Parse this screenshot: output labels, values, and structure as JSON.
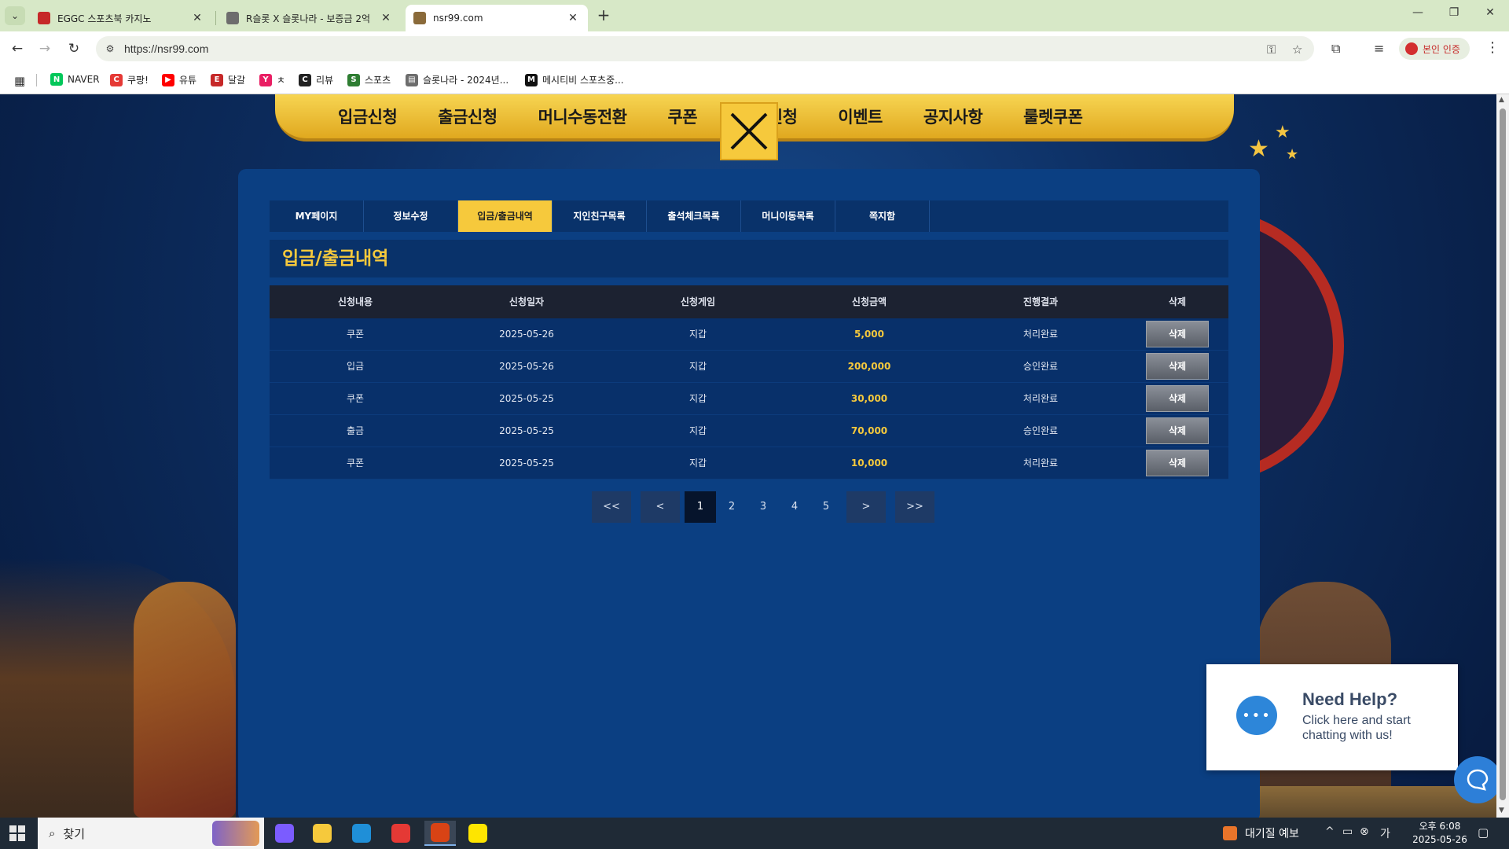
{
  "browser": {
    "tabs": [
      {
        "title": "EGGC 스포츠북 카지노",
        "active": false,
        "favicon_color": "#c62828"
      },
      {
        "title": "R슬롯 X 슬롯나라 - 보증금 2억",
        "active": false,
        "favicon_color": "#6d6d6d"
      },
      {
        "title": "nsr99.com",
        "active": true,
        "favicon_color": "#8a6a3a"
      }
    ],
    "url": "https://nsr99.com",
    "profile_label": "본인 인증",
    "bookmarks": [
      {
        "label": "NAVER",
        "icon_text": "N",
        "color": "#03c75a"
      },
      {
        "label": "쿠팡!",
        "icon_text": "C",
        "color": "#e53935"
      },
      {
        "label": "유튜",
        "icon_text": "▶",
        "color": "#ff0000"
      },
      {
        "label": "달갈",
        "icon_text": "E",
        "color": "#c62828"
      },
      {
        "label": "ㅊ",
        "icon_text": "Y",
        "color": "#e91e63"
      },
      {
        "label": "리뷰",
        "icon_text": "C",
        "color": "#222222"
      },
      {
        "label": "스포츠",
        "icon_text": "S",
        "color": "#2e7d32"
      },
      {
        "label": "슬롯나라 - 2024년...",
        "icon_text": "▤",
        "color": "#6d6d6d"
      },
      {
        "label": "메시티비 스포츠중...",
        "icon_text": "M",
        "color": "#111111"
      }
    ]
  },
  "site": {
    "nav_items": [
      "입금신청",
      "출금신청",
      "머니수동전환",
      "쿠폰",
      "콤프신청",
      "이벤트",
      "공지사항",
      "룰렛쿠폰"
    ],
    "subtabs": [
      "MY페이지",
      "정보수정",
      "입금/출금내역",
      "지인친구목록",
      "출석체크목록",
      "머니이동목록",
      "쪽지함"
    ],
    "active_subtab": 2,
    "section_title": "입금/출금내역",
    "table": {
      "headers": [
        "신청내용",
        "신청일자",
        "신청게임",
        "신청금액",
        "진행결과",
        "삭제"
      ],
      "rows": [
        {
          "type": "쿠폰",
          "date": "2025-05-26",
          "game": "지갑",
          "amount": "5,000",
          "result": "처리완료",
          "action": "삭제"
        },
        {
          "type": "입금",
          "date": "2025-05-26",
          "game": "지갑",
          "amount": "200,000",
          "result": "승인완료",
          "action": "삭제"
        },
        {
          "type": "쿠폰",
          "date": "2025-05-25",
          "game": "지갑",
          "amount": "30,000",
          "result": "처리완료",
          "action": "삭제"
        },
        {
          "type": "출금",
          "date": "2025-05-25",
          "game": "지갑",
          "amount": "70,000",
          "result": "승인완료",
          "action": "삭제"
        },
        {
          "type": "쿠폰",
          "date": "2025-05-25",
          "game": "지갑",
          "amount": "10,000",
          "result": "처리완료",
          "action": "삭제"
        }
      ]
    },
    "pagination": {
      "first": "<<",
      "prev": "<",
      "pages": [
        "1",
        "2",
        "3",
        "4",
        "5"
      ],
      "current": "1",
      "next": ">",
      "last": ">>"
    },
    "help_widget": {
      "title": "Need Help?",
      "text": "Click here and start chatting with us!"
    }
  },
  "taskbar": {
    "search_placeholder": "찾기",
    "weather": "대기질 예보",
    "time": "오후 6:08",
    "date": "2025-05-26",
    "apps": [
      {
        "name": "copilot",
        "color": "#7b5cff"
      },
      {
        "name": "sticky-notes",
        "color": "#f6c93c"
      },
      {
        "name": "edge",
        "color": "#1f8fd8"
      },
      {
        "name": "chrome",
        "color": "#e53935"
      },
      {
        "name": "chrome-profile",
        "color": "#d84315"
      },
      {
        "name": "kakaotalk",
        "color": "#fee500"
      }
    ]
  }
}
